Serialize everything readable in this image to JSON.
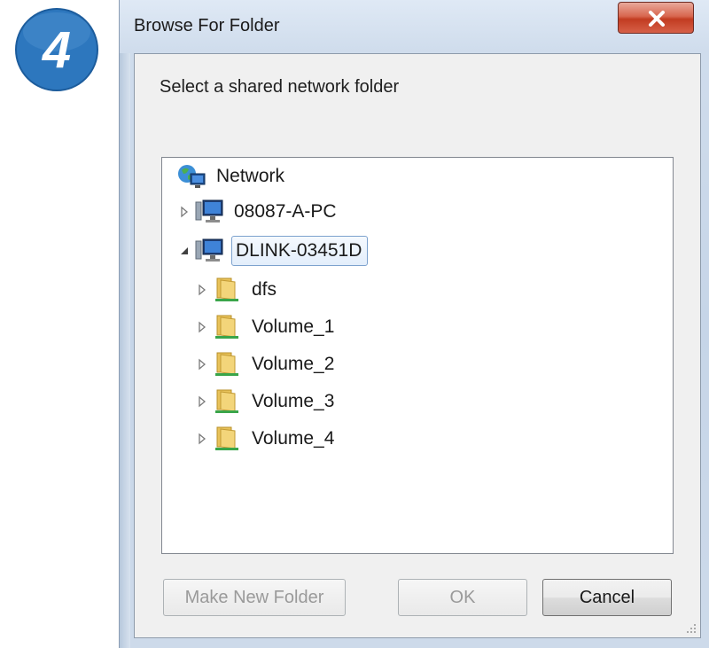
{
  "step": {
    "number": "4",
    "color": "#2d77be"
  },
  "dialog": {
    "title": "Browse For Folder",
    "close_icon": "close-icon",
    "prompt": "Select a shared network folder"
  },
  "tree": {
    "items": [
      {
        "label": "Network",
        "icon": "network-icon",
        "expander": "none",
        "level": 0
      },
      {
        "label": "08087-A-PC",
        "icon": "computer-icon",
        "expander": "collapsed",
        "level": 0
      },
      {
        "label": "DLINK-03451D",
        "icon": "computer-icon",
        "expander": "expanded",
        "level": 0,
        "selected": true
      },
      {
        "label": "dfs",
        "icon": "shared-folder-icon",
        "expander": "collapsed",
        "level": 1
      },
      {
        "label": "Volume_1",
        "icon": "shared-folder-icon",
        "expander": "collapsed",
        "level": 1
      },
      {
        "label": "Volume_2",
        "icon": "shared-folder-icon",
        "expander": "collapsed",
        "level": 1
      },
      {
        "label": "Volume_3",
        "icon": "shared-folder-icon",
        "expander": "collapsed",
        "level": 1
      },
      {
        "label": "Volume_4",
        "icon": "shared-folder-icon",
        "expander": "collapsed",
        "level": 1
      }
    ]
  },
  "buttons": {
    "make_new_folder": "Make New Folder",
    "ok": "OK",
    "cancel": "Cancel"
  }
}
